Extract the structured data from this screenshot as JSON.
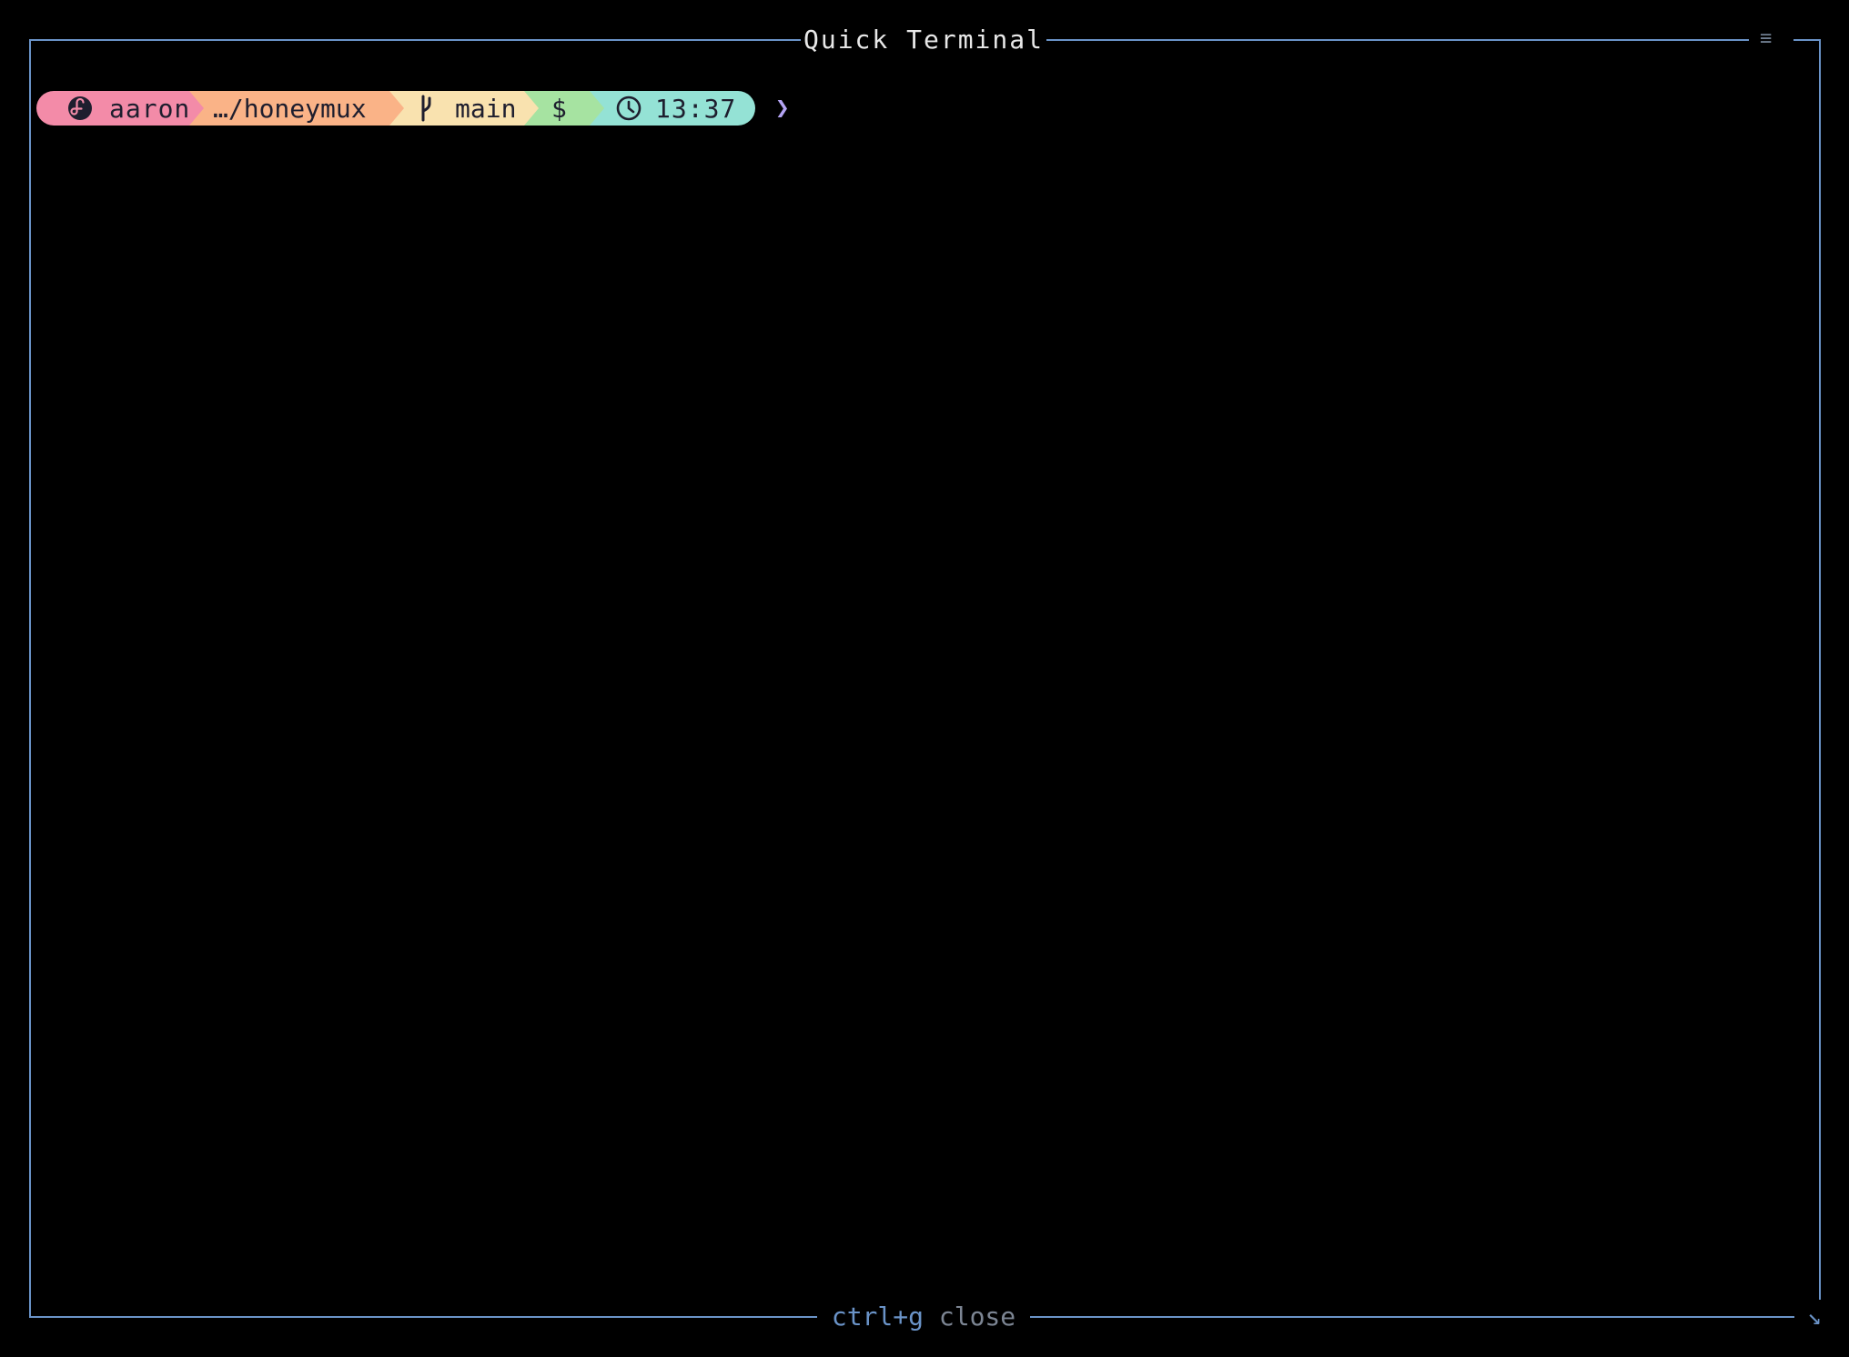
{
  "window": {
    "title": "Quick Terminal",
    "menu_icon": "≡",
    "resize_icon": "↘"
  },
  "footer": {
    "key": "ctrl+g",
    "action": "close"
  },
  "prompt": {
    "os_icon": "fedora-icon",
    "user": "aaron",
    "directory": "…/honeymux",
    "git_icon": "git-branch-icon",
    "branch": "main",
    "status": "$",
    "clock_icon": "clock-icon",
    "time": "13:37",
    "prompt_char": "❯"
  },
  "colors": {
    "border": "#6a93c8",
    "user_segment": "#f38ba8",
    "directory_segment": "#fab387",
    "git_segment": "#f9e2af",
    "status_segment": "#a6e3a1",
    "time_segment": "#94e2d5",
    "prompt_char": "#b4a4f4"
  }
}
